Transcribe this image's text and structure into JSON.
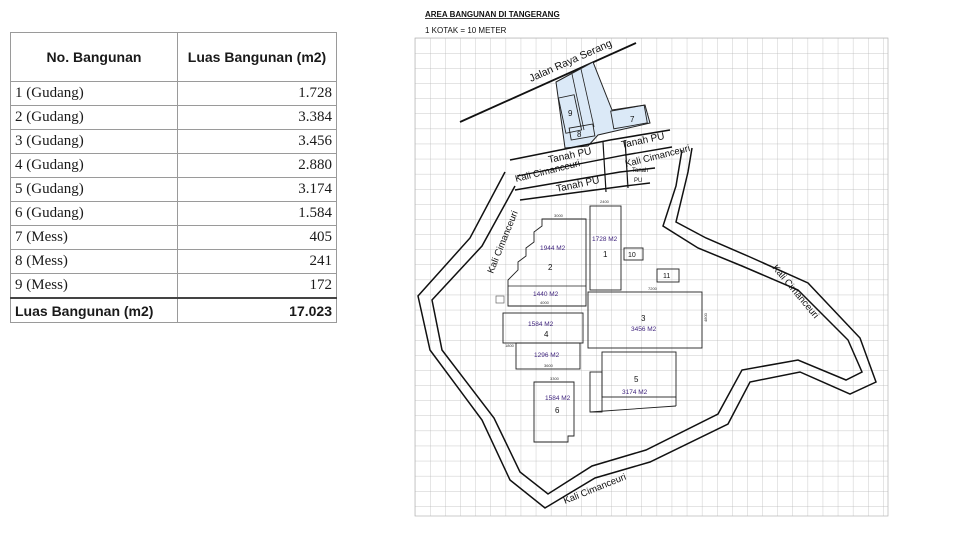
{
  "table": {
    "header_no": "No. Bangunan",
    "header_luas": "Luas Bangunan (m2)",
    "rows": [
      {
        "name": "1 (Gudang)",
        "area": "1.728"
      },
      {
        "name": "2 (Gudang)",
        "area": "3.384"
      },
      {
        "name": "3 (Gudang)",
        "area": "3.456"
      },
      {
        "name": "4 (Gudang)",
        "area": "2.880"
      },
      {
        "name": "5 (Gudang)",
        "area": "3.174"
      },
      {
        "name": "6 (Gudang)",
        "area": "1.584"
      },
      {
        "name": "7 (Mess)",
        "area": "405"
      },
      {
        "name": "8 (Mess)",
        "area": "241"
      },
      {
        "name": "9 (Mess)",
        "area": "172"
      }
    ],
    "total_label": "Luas Bangunan (m2)",
    "total_value": "17.023"
  },
  "map": {
    "title": "AREA BANGUNAN DI TANGERANG",
    "scale": "1 KOTAK = 10 METER",
    "road": "Jalan Raya Serang",
    "river": "Kali Cimanceuri",
    "tanah_pu": "Tanah PU",
    "tanah_small_1": "Tanah",
    "tanah_small_2": "PU",
    "bldg_1": "1",
    "bldg_2": "2",
    "bldg_3": "3",
    "bldg_4": "4",
    "bldg_5": "5",
    "bldg_6": "6",
    "bldg_7": "7",
    "bldg_8": "8",
    "bldg_9": "9",
    "bldg_10": "10",
    "bldg_11": "11",
    "area_1": "1728 M2",
    "area_2a": "1944 M2",
    "area_2b": "1440 M2",
    "area_3": "3456 M2",
    "area_4a": "1584 M2",
    "area_4b": "1296 M2",
    "area_5": "3174 M2",
    "area_6": "1584 M2",
    "dim_3000": "3000",
    "dim_2400": "2400",
    "dim_7200": "7200",
    "dim_4800": "4800",
    "dim_4200": "4200",
    "dim_3600": "3600",
    "dim_4000": "4000",
    "dim_3300": "3300",
    "dim_1800": "1800",
    "dim_2200": "2200",
    "dim_2500": "2500",
    "colors": {
      "building_fill": "#dbe9f7",
      "area_text": "#3b1f7a",
      "grid": "#b5b5b5"
    }
  }
}
